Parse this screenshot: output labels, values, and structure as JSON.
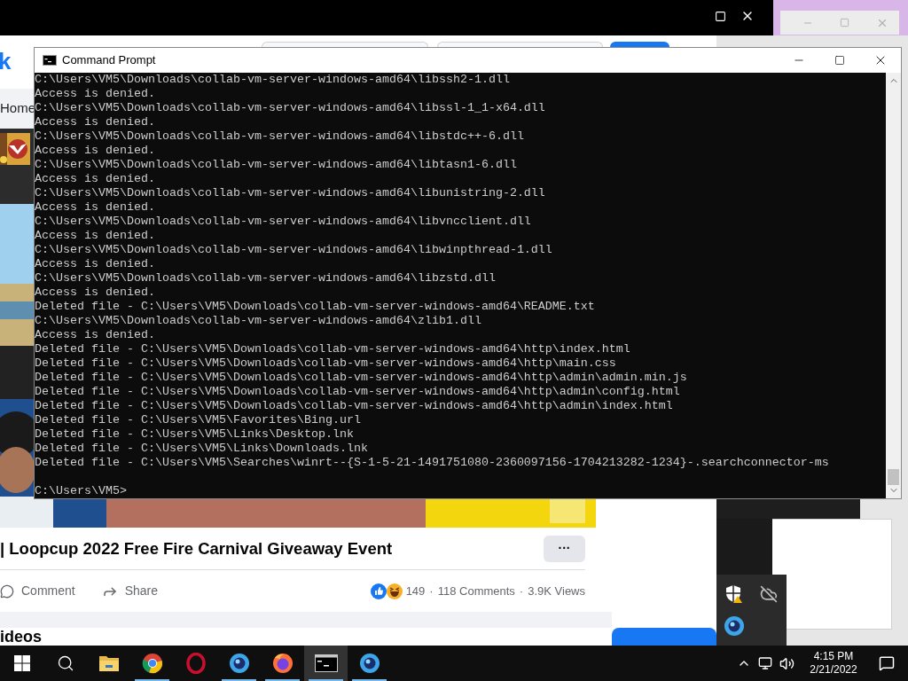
{
  "browser": {
    "logo_fragment": "k",
    "nav_item": "Home",
    "post": {
      "title": "| Loopcup 2022 Free Fire Carnival Giveaway Event",
      "more_button": "···",
      "actions": [
        {
          "kind": "comment",
          "label": "Comment"
        },
        {
          "kind": "share",
          "label": "Share"
        }
      ],
      "reactions_count": "149",
      "stats": [
        {
          "kind": "separator",
          "text": "·"
        },
        {
          "kind": "stat",
          "text": "118 Comments"
        },
        {
          "kind": "separator",
          "text": "·"
        },
        {
          "kind": "stat",
          "text": "3.9K Views"
        }
      ]
    },
    "section_heading": "ideos"
  },
  "command_prompt": {
    "title": "Command Prompt",
    "lines": [
      "C:\\Users\\VM5\\Downloads\\collab-vm-server-windows-amd64\\libssh2-1.dll",
      "Access is denied.",
      "C:\\Users\\VM5\\Downloads\\collab-vm-server-windows-amd64\\libssl-1_1-x64.dll",
      "Access is denied.",
      "C:\\Users\\VM5\\Downloads\\collab-vm-server-windows-amd64\\libstdc++-6.dll",
      "Access is denied.",
      "C:\\Users\\VM5\\Downloads\\collab-vm-server-windows-amd64\\libtasn1-6.dll",
      "Access is denied.",
      "C:\\Users\\VM5\\Downloads\\collab-vm-server-windows-amd64\\libunistring-2.dll",
      "Access is denied.",
      "C:\\Users\\VM5\\Downloads\\collab-vm-server-windows-amd64\\libvncclient.dll",
      "Access is denied.",
      "C:\\Users\\VM5\\Downloads\\collab-vm-server-windows-amd64\\libwinpthread-1.dll",
      "Access is denied.",
      "C:\\Users\\VM5\\Downloads\\collab-vm-server-windows-amd64\\libzstd.dll",
      "Access is denied.",
      "Deleted file - C:\\Users\\VM5\\Downloads\\collab-vm-server-windows-amd64\\README.txt",
      "C:\\Users\\VM5\\Downloads\\collab-vm-server-windows-amd64\\zlib1.dll",
      "Access is denied.",
      "Deleted file - C:\\Users\\VM5\\Downloads\\collab-vm-server-windows-amd64\\http\\index.html",
      "Deleted file - C:\\Users\\VM5\\Downloads\\collab-vm-server-windows-amd64\\http\\main.css",
      "Deleted file - C:\\Users\\VM5\\Downloads\\collab-vm-server-windows-amd64\\http\\admin\\admin.min.js",
      "Deleted file - C:\\Users\\VM5\\Downloads\\collab-vm-server-windows-amd64\\http\\admin\\config.html",
      "Deleted file - C:\\Users\\VM5\\Downloads\\collab-vm-server-windows-amd64\\http\\admin\\index.html",
      "Deleted file - C:\\Users\\VM5\\Favorites\\Bing.url",
      "Deleted file - C:\\Users\\VM5\\Links\\Desktop.lnk",
      "Deleted file - C:\\Users\\VM5\\Links\\Downloads.lnk",
      "Deleted file - C:\\Users\\VM5\\Searches\\winrt--{S-1-5-21-1491751080-2360097156-1704213282-1234}-.searchconnector-ms"
    ],
    "prompt": "C:\\Users\\VM5>"
  },
  "taskbar": {
    "apps": [
      {
        "kind": "start",
        "running": false,
        "active": false
      },
      {
        "kind": "search",
        "running": false,
        "active": false
      },
      {
        "kind": "explorer",
        "running": false,
        "active": false
      },
      {
        "kind": "chrome",
        "running": true,
        "active": false
      },
      {
        "kind": "opera",
        "running": false,
        "active": false
      },
      {
        "kind": "orb",
        "running": true,
        "active": false
      },
      {
        "kind": "firefox",
        "running": true,
        "active": false
      },
      {
        "kind": "cmd",
        "running": true,
        "active": true
      },
      {
        "kind": "orb",
        "running": true,
        "active": false
      }
    ],
    "time": "4:15 PM",
    "date": "2/21/2022"
  }
}
